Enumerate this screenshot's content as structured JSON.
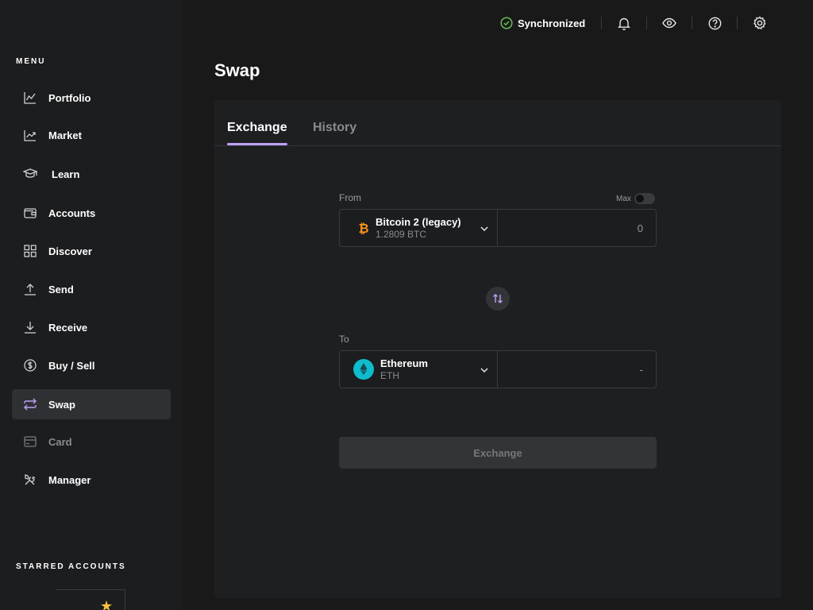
{
  "sidebar": {
    "menu_title": "MENU",
    "items": [
      {
        "label": "Portfolio",
        "icon": "chart-line-icon"
      },
      {
        "label": "Market",
        "icon": "market-chart-icon"
      },
      {
        "label": "Learn",
        "icon": "graduation-cap-icon"
      },
      {
        "label": "Accounts",
        "icon": "wallet-icon"
      },
      {
        "label": "Discover",
        "icon": "grid-icon"
      },
      {
        "label": "Send",
        "icon": "arrow-up-icon"
      },
      {
        "label": "Receive",
        "icon": "arrow-down-icon"
      },
      {
        "label": "Buy / Sell",
        "icon": "dollar-circle-icon"
      },
      {
        "label": "Swap",
        "icon": "swap-arrows-icon"
      },
      {
        "label": "Card",
        "icon": "card-icon"
      },
      {
        "label": "Manager",
        "icon": "tools-icon"
      }
    ],
    "active_item": "Swap",
    "disabled_item": "Card",
    "starred_title": "STARRED ACCOUNTS"
  },
  "topbar": {
    "sync_status": "Synchronized"
  },
  "page": {
    "title": "Swap"
  },
  "tabs": {
    "exchange": "Exchange",
    "history": "History"
  },
  "form": {
    "from_label": "From",
    "max_label": "Max",
    "from_account_name": "Bitcoin 2 (legacy)",
    "from_account_balance": "1.2809 BTC",
    "from_amount": "0",
    "to_label": "To",
    "to_account_name": "Ethereum",
    "to_account_ticker": "ETH",
    "to_amount": "-",
    "exchange_button": "Exchange"
  },
  "colors": {
    "accent": "#bba2f5",
    "sync_green": "#66be54",
    "btc_orange": "#f7931a",
    "eth_teal": "#0ebdcd",
    "star_yellow": "#f5c13d"
  }
}
